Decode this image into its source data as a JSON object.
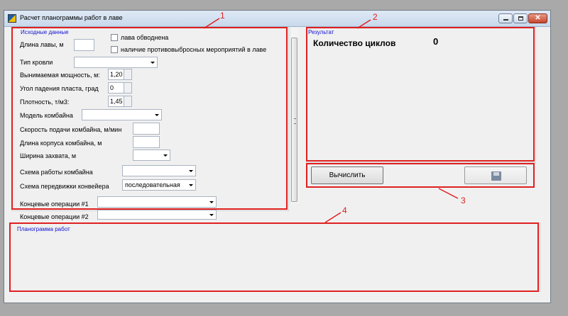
{
  "window": {
    "title": "Расчет планограммы работ в лаве"
  },
  "input": {
    "group_title": "Исходные данные",
    "lava_length_label": "Длина лавы, м",
    "lava_length_value": "",
    "checkbox_watered_label": "лава обводнена",
    "checkbox_outburst_label": "наличие противовыбросных мероприятий в лаве",
    "roof_type_label": "Тип кровли",
    "roof_type_value": "",
    "thickness_label": "Вынимаемая мощность, м:",
    "thickness_value": "1,20",
    "angle_label": "Угол падения пласта, град",
    "angle_value": "0",
    "density_label": "Плотность, т/м3:",
    "density_value": "1,45",
    "combine_model_label": "Модель комбайна",
    "combine_model_value": "",
    "feed_speed_label": "Скорость подачи комбайна, м/мин",
    "feed_speed_value": "",
    "body_length_label": "Длина корпуса комбайна, м",
    "body_length_value": "",
    "capture_width_label": "Ширина захвата, м",
    "capture_width_value": "",
    "work_scheme_label": "Схема работы комбайна",
    "work_scheme_value": "",
    "conveyor_scheme_label": "Схема передвижки конвейера",
    "conveyor_scheme_value": "последовательная",
    "end_ops1_label": "Концевые операции #1",
    "end_ops1_value": "",
    "end_ops2_label": "Концевые операции #2",
    "end_ops2_value": ""
  },
  "result": {
    "group_title": "Результат",
    "cycles_label": "Количество циклов",
    "cycles_value": "0"
  },
  "actions": {
    "calculate_label": "Вычислить",
    "save_icon": "floppy-disk-icon"
  },
  "planogram": {
    "group_title": "Планограмма работ"
  },
  "annotations": {
    "a1": "1",
    "a2": "2",
    "a3": "3",
    "a4": "4"
  },
  "colors": {
    "annotation": "#e02020",
    "group_title": "#1010d0"
  }
}
